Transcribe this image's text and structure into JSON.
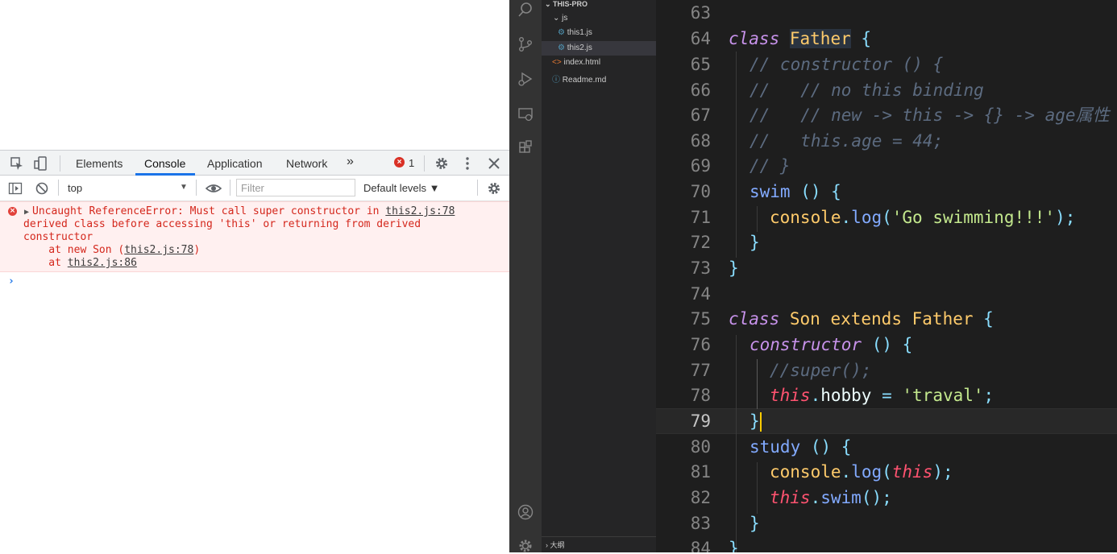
{
  "devtools": {
    "tabs": [
      "Elements",
      "Console",
      "Application",
      "Network"
    ],
    "more_tabs_icon": "»",
    "error_count": "1",
    "context": "top",
    "filter_placeholder": "Filter",
    "levels": "Default levels ▼"
  },
  "console": {
    "error": {
      "line1_text": "Uncaught ReferenceError: Must call super constructor in ",
      "line1_link": "this2.js:78",
      "line2": "derived class before accessing 'this' or returning from derived",
      "line3": "constructor",
      "stack1_prefix": "    at new Son (",
      "stack1_link": "this2.js:78",
      "stack1_suffix": ")",
      "stack2_prefix": "    at ",
      "stack2_link": "this2.js:86"
    },
    "prompt": "›"
  },
  "vscode": {
    "explorer": {
      "root": "THIS-PRO",
      "folder": "js",
      "files_in_folder": [
        "this1.js",
        "this2.js"
      ],
      "files": [
        "index.html",
        "Readme.md"
      ],
      "outline_label": "大纲"
    },
    "line_numbers": [
      "63",
      "64",
      "65",
      "66",
      "67",
      "68",
      "69",
      "70",
      "71",
      "72",
      "73",
      "74",
      "75",
      "76",
      "77",
      "78",
      "79",
      "80",
      "81",
      "82",
      "83",
      "84"
    ],
    "code": {
      "l64": {
        "kw": "class",
        "name": "Father",
        "brace": "{"
      },
      "l65": "// constructor () {",
      "l66": "//   // no this binding",
      "l67": "//   // new -> this -> {} -> age属性",
      "l68": "//   this.age = 44;",
      "l69": "// }",
      "l70": {
        "fn": "swim",
        "rest": " () {"
      },
      "l71": {
        "obj": "console",
        "dot": ".",
        "fn": "log",
        "open": "(",
        "str": "'Go swimming!!!'",
        "close": ");"
      },
      "l72": "}",
      "l73": "}",
      "l75": {
        "kw": "class",
        "name": "Son",
        "ext": "extends",
        "parent": "Father",
        "brace": "{"
      },
      "l76": {
        "kw": "constructor",
        "rest": " () {"
      },
      "l77": "//super();",
      "l78": {
        "this": "this",
        "dot": ".",
        "prop": "hobby",
        "eq": " = ",
        "str": "'traval'",
        "end": ";"
      },
      "l79": "}",
      "l80": {
        "fn": "study",
        "rest": " () {"
      },
      "l81": {
        "obj": "console",
        "dot": ".",
        "fn": "log",
        "open": "(",
        "this": "this",
        "close": ");"
      },
      "l82": {
        "this": "this",
        "dot": ".",
        "fn": "swim",
        "close": "();"
      },
      "l83": "}",
      "l84": "}"
    }
  }
}
